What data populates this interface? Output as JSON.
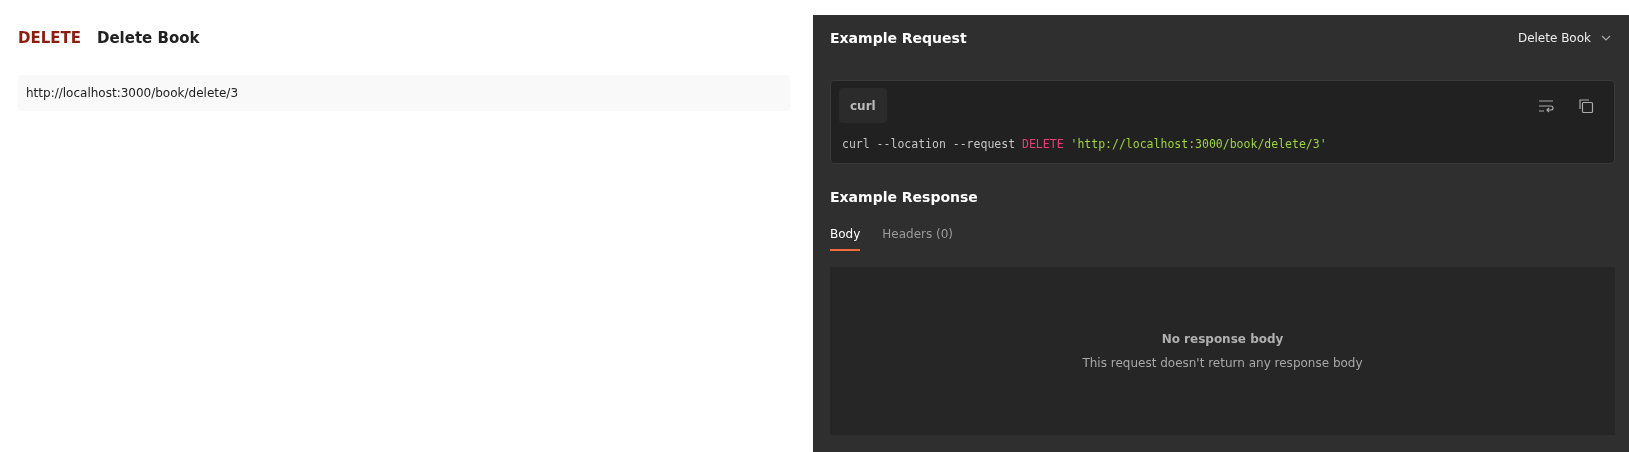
{
  "request": {
    "method": "DELETE",
    "name": "Delete Book",
    "url": "http://localhost:3000/book/delete/3"
  },
  "example_request": {
    "title": "Example Request",
    "example_selector": "Delete Book",
    "language_tab": "curl",
    "code": [
      {
        "kind": "plain",
        "text": "curl --location --request "
      },
      {
        "kind": "method",
        "text": "DELETE"
      },
      {
        "kind": "string",
        "text": "'http://localhost:3000/book/delete/3'"
      }
    ]
  },
  "example_response": {
    "title": "Example Response",
    "tabs": [
      {
        "label": "Body",
        "selected": true
      },
      {
        "label": "Headers (0)",
        "selected": false
      }
    ],
    "empty_title": "No response body",
    "empty_message": "This request doesn't return any response body"
  }
}
